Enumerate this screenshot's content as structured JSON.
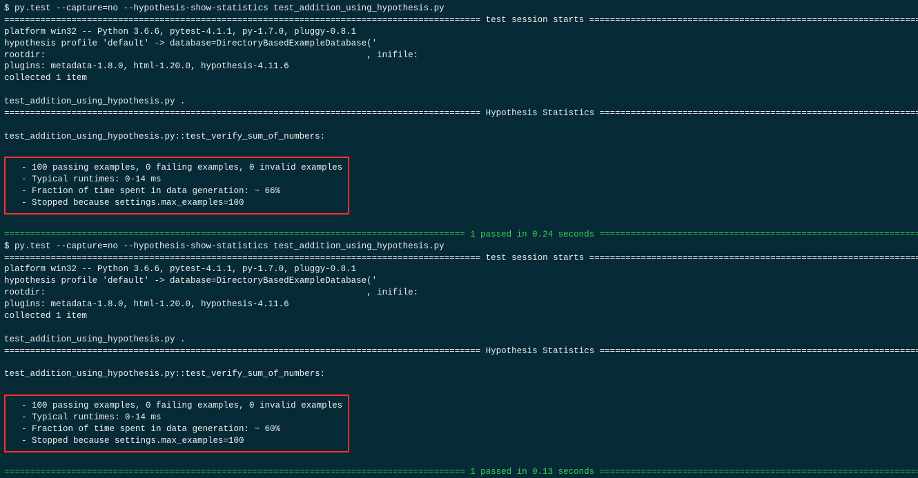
{
  "runs": [
    {
      "prompt": "$ ",
      "command": "py.test --capture=no --hypothesis-show-statistics test_addition_using_hypothesis.py",
      "session_header": "============================================================================================ test session starts ============================================================================================",
      "platform": "platform win32 -- Python 3.6.6, pytest-4.1.1, py-1.7.0, pluggy-0.8.1",
      "hypothesis_profile": "hypothesis profile 'default' -> database=DirectoryBasedExampleDatabase('                                                                                                                                    ')",
      "rootdir": "rootdir:                                                              , inifile:",
      "plugins": "plugins: metadata-1.8.0, html-1.20.0, hypothesis-4.11.6",
      "collected": "collected 1 item",
      "test_file_progress": "test_addition_using_hypothesis.py .",
      "stats_header": "============================================================================================ Hypothesis Statistics ============================================================================================",
      "test_name": "test_addition_using_hypothesis.py::test_verify_sum_of_numbers:",
      "stats": [
        "  - 100 passing examples, 0 failing examples, 0 invalid examples",
        "  - Typical runtimes: 0-14 ms",
        "  - Fraction of time spent in data generation: ~ 66%",
        "  - Stopped because settings.max_examples=100"
      ],
      "result": "========================================================================================= 1 passed in 0.24 seconds =========================================================================================="
    },
    {
      "prompt": "$ ",
      "command": "py.test --capture=no --hypothesis-show-statistics test_addition_using_hypothesis.py",
      "session_header": "============================================================================================ test session starts ============================================================================================",
      "platform": "platform win32 -- Python 3.6.6, pytest-4.1.1, py-1.7.0, pluggy-0.8.1",
      "hypothesis_profile": "hypothesis profile 'default' -> database=DirectoryBasedExampleDatabase('                                                                                                                                    ')",
      "rootdir": "rootdir:                                                              , inifile:",
      "plugins": "plugins: metadata-1.8.0, html-1.20.0, hypothesis-4.11.6",
      "collected": "collected 1 item",
      "test_file_progress": "test_addition_using_hypothesis.py .",
      "stats_header": "============================================================================================ Hypothesis Statistics ============================================================================================",
      "test_name": "test_addition_using_hypothesis.py::test_verify_sum_of_numbers:",
      "stats": [
        "  - 100 passing examples, 0 failing examples, 0 invalid examples",
        "  - Typical runtimes: 0-14 ms",
        "  - Fraction of time spent in data generation: ~ 60%",
        "  - Stopped because settings.max_examples=100"
      ],
      "result": "========================================================================================= 1 passed in 0.13 seconds =========================================================================================="
    }
  ]
}
